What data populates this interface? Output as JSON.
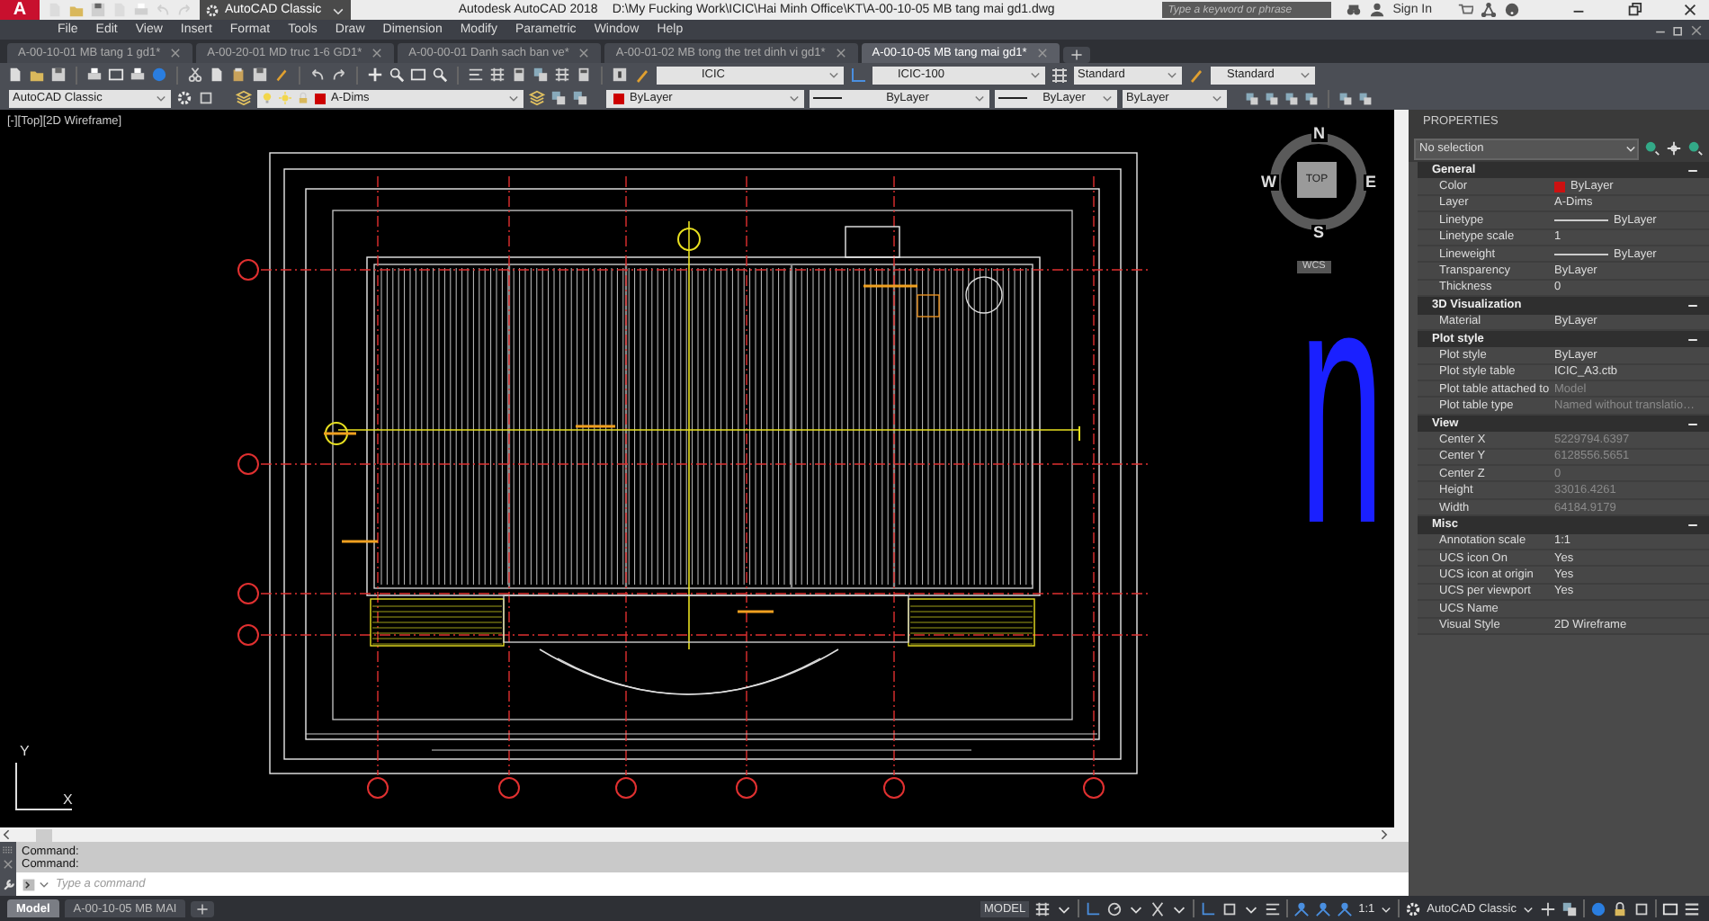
{
  "title_bar": {
    "app_logo": "A",
    "workspace": "AutoCAD Classic",
    "app_name": "Autodesk AutoCAD 2018",
    "file_path": "D:\\My Fucking Work\\ICIC\\Hai Minh Office\\KT\\A-00-10-05 MB tang mai gd1.dwg",
    "search": {
      "placeholder": "Type a keyword or phrase"
    },
    "sign_in": "Sign In"
  },
  "menu_bar": [
    "File",
    "Edit",
    "View",
    "Insert",
    "Format",
    "Tools",
    "Draw",
    "Dimension",
    "Modify",
    "Parametric",
    "Window",
    "Help"
  ],
  "file_tabs": [
    {
      "label": "A-00-10-01 MB tang 1 gd1*",
      "selected": false
    },
    {
      "label": "A-00-20-01 MD truc 1-6 GD1*",
      "selected": false
    },
    {
      "label": "A-00-00-01 Danh sach ban ve*",
      "selected": false
    },
    {
      "label": "A-00-01-02 MB tong the tret dinh vi gd1*",
      "selected": false
    },
    {
      "label": "A-00-10-05 MB tang mai gd1*",
      "selected": true
    }
  ],
  "toolbar_1": {
    "text_style": "ICIC",
    "dim_style": "ICIC-100",
    "table_style": "Standard",
    "multileader_style": "Standard"
  },
  "toolbar_2": {
    "workspace": "AutoCAD Classic",
    "layer": "A-Dims",
    "color_control": "ByLayer",
    "linetype": "ByLayer",
    "lineweight": "ByLayer",
    "plot_style": "ByLayer"
  },
  "viewport": {
    "label": "[-][Top][2D Wireframe]",
    "viewcube": {
      "north": "N",
      "south": "S",
      "east": "E",
      "west": "W",
      "face": "TOP",
      "ucs": "WCS"
    },
    "canvas_text": "n",
    "ucs_icon": {
      "x": "X",
      "y": "Y"
    }
  },
  "properties": {
    "title": "PROPERTIES",
    "selection": "No selection",
    "sections": [
      {
        "title": "General",
        "expanded": true,
        "rows": [
          {
            "label": "Color",
            "value": "ByLayer",
            "kind": "color",
            "color": "#cc1111",
            "disabled": false
          },
          {
            "label": "Layer",
            "value": "A-Dims",
            "kind": "text",
            "disabled": false
          },
          {
            "label": "Linetype",
            "value": "ByLayer",
            "kind": "line",
            "disabled": false
          },
          {
            "label": "Linetype scale",
            "value": "1",
            "kind": "text",
            "disabled": false
          },
          {
            "label": "Lineweight",
            "value": "ByLayer",
            "kind": "line",
            "disabled": false
          },
          {
            "label": "Transparency",
            "value": "ByLayer",
            "kind": "text",
            "disabled": false
          },
          {
            "label": "Thickness",
            "value": "0",
            "kind": "text",
            "disabled": false
          }
        ]
      },
      {
        "title": "3D Visualization",
        "expanded": true,
        "rows": [
          {
            "label": "Material",
            "value": "ByLayer",
            "kind": "text",
            "disabled": false
          }
        ]
      },
      {
        "title": "Plot style",
        "expanded": true,
        "rows": [
          {
            "label": "Plot style",
            "value": "ByLayer",
            "kind": "text",
            "disabled": false
          },
          {
            "label": "Plot style table",
            "value": "ICIC_A3.ctb",
            "kind": "text",
            "disabled": false
          },
          {
            "label": "Plot table attached to",
            "value": "Model",
            "kind": "text",
            "disabled": true
          },
          {
            "label": "Plot table type",
            "value": "Named without translatio…",
            "kind": "text",
            "disabled": true
          }
        ]
      },
      {
        "title": "View",
        "expanded": true,
        "rows": [
          {
            "label": "Center X",
            "value": "5229794.6397",
            "kind": "text",
            "disabled": true
          },
          {
            "label": "Center Y",
            "value": "6128556.5651",
            "kind": "text",
            "disabled": true
          },
          {
            "label": "Center Z",
            "value": "0",
            "kind": "text",
            "disabled": true
          },
          {
            "label": "Height",
            "value": "33016.4261",
            "kind": "text",
            "disabled": true
          },
          {
            "label": "Width",
            "value": "64184.9179",
            "kind": "text",
            "disabled": true
          }
        ]
      },
      {
        "title": "Misc",
        "expanded": true,
        "rows": [
          {
            "label": "Annotation scale",
            "value": "1:1",
            "kind": "text",
            "disabled": false
          },
          {
            "label": "UCS icon On",
            "value": "Yes",
            "kind": "text",
            "disabled": false
          },
          {
            "label": "UCS icon at origin",
            "value": "Yes",
            "kind": "text",
            "disabled": false
          },
          {
            "label": "UCS per viewport",
            "value": "Yes",
            "kind": "text",
            "disabled": false
          },
          {
            "label": "UCS Name",
            "kind": "text",
            "disabled": false
          },
          {
            "label": "Visual Style",
            "value": "2D Wireframe",
            "kind": "text",
            "disabled": false
          }
        ]
      }
    ]
  },
  "command_line": {
    "history": [
      "Command:",
      "Command:"
    ],
    "placeholder": "Type a command"
  },
  "layout_tabs": [
    {
      "label": "Model",
      "selected": true
    },
    {
      "label": "A-00-10-05 MB MAI",
      "selected": false
    }
  ],
  "status_bar": {
    "mode": "MODEL",
    "scale": "1:1",
    "workspace": "AutoCAD Classic"
  }
}
